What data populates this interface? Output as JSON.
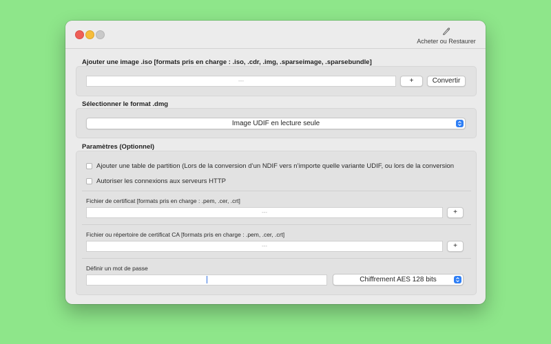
{
  "titlebar": {
    "buy_restore_label": "Acheter ou Restaurer",
    "buy_restore_icon": "pen-icon"
  },
  "image_section": {
    "title": "Ajouter une image .iso [formats pris en charge : .iso, .cdr, .img, .sparseimage, .sparsebundle]",
    "field_placeholder": "---",
    "add_label": "+",
    "convert_label": "Convertir"
  },
  "format_section": {
    "title": "Sélectionner le format .dmg",
    "selected": "Image UDIF en lecture seule"
  },
  "params_section": {
    "title": "Paramètres (Optionnel)",
    "checkbox_partition": "Ajouter une table de partition (Lors de la conversion d’un NDIF vers n’importe quelle variante UDIF, ou lors de la conversion",
    "checkbox_http": "Autoriser les connexions aux serveurs HTTP",
    "cert_label": "Fichier de certificat [formats pris en charge : .pem, .cer, .crt]",
    "cert_placeholder": "---",
    "cert_add_label": "+",
    "ca_label": "Fichier ou répertoire de certificat CA [formats pris en charge : .pem, .cer, .crt]",
    "ca_placeholder": "---",
    "ca_add_label": "+",
    "password_label": "Définir un mot de passe",
    "encryption_selected": "Chiffrement AES 128 bits"
  },
  "colors": {
    "background": "#8ee68a",
    "accent": "#2f7ff5"
  }
}
